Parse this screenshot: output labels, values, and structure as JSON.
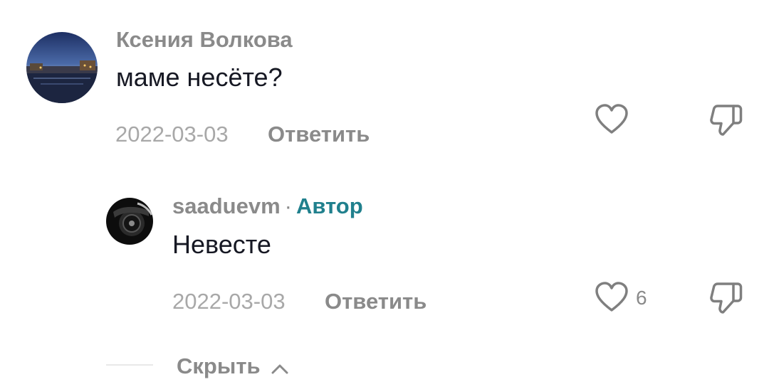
{
  "comments": [
    {
      "username": "Ксения Волкова",
      "text": "маме несёте?",
      "date": "2022-03-03",
      "reply_label": "Ответить",
      "likes": ""
    }
  ],
  "replies": [
    {
      "username": "saaduevm",
      "separator": "·",
      "badge": "Автор",
      "text": "Невесте",
      "date": "2022-03-03",
      "reply_label": "Ответить",
      "likes": "6"
    }
  ],
  "hide_label": "Скрыть",
  "colors": {
    "author_badge": "#20808d",
    "muted": "#8a8a8a",
    "text": "#161823"
  },
  "icons": {
    "like": "heart-outline-icon",
    "dislike": "thumbs-down-outline-icon",
    "collapse": "chevron-up-icon"
  }
}
